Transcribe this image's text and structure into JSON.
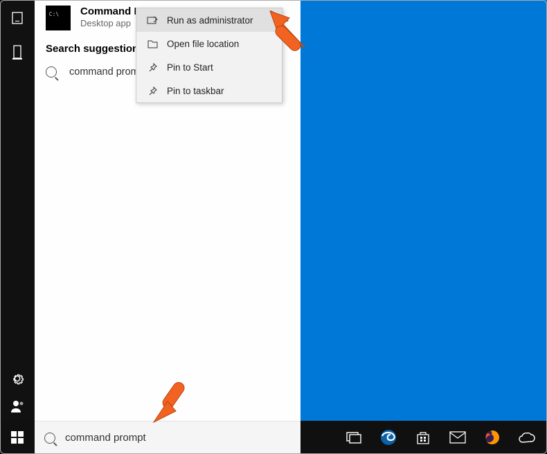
{
  "best_match": {
    "title": "Command Prompt",
    "subtitle": "Desktop app"
  },
  "suggestions": {
    "header": "Search suggestions",
    "items": [
      {
        "text": "command prompt - See web results"
      }
    ]
  },
  "context_menu": {
    "items": [
      {
        "label": "Run as administrator",
        "icon": "admin-shield-icon"
      },
      {
        "label": "Open file location",
        "icon": "folder-icon"
      },
      {
        "label": "Pin to Start",
        "icon": "pin-icon"
      },
      {
        "label": "Pin to taskbar",
        "icon": "pin-icon"
      }
    ]
  },
  "search_input": {
    "value": "command prompt"
  },
  "colors": {
    "desktop": "#0078d7",
    "accent_arrow": "#f26322"
  }
}
